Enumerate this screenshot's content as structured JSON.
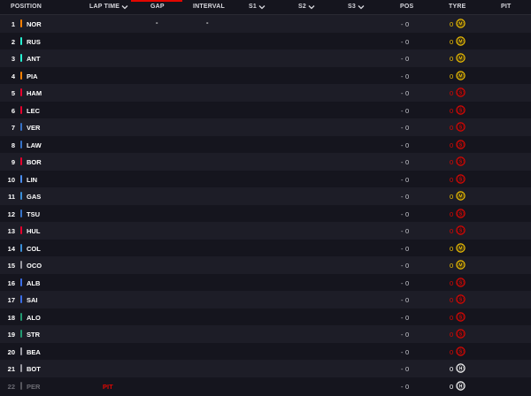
{
  "header": {
    "position": "POSITION",
    "lap_time": "LAP TIME",
    "gap": "GAP",
    "interval": "INTERVAL",
    "s1": "S1",
    "s2": "S2",
    "s3": "S3",
    "pos": "POS",
    "tyre": "TYRE",
    "pit": "PIT"
  },
  "colors": {
    "accent": "#e10600",
    "medium": "#f5c400",
    "soft": "#e10600",
    "hard": "#ffffff",
    "pit_text": "#e10600"
  },
  "drivers": [
    {
      "pos": "1",
      "code": "NOR",
      "team_color": "#ff8000",
      "lap_time": "",
      "gap": "-",
      "interval": "-",
      "pos_change": "-",
      "pos_val": "0",
      "tyre_age": "0",
      "tyre": "M",
      "tyre_color": "#f5c400",
      "tyre_icon": "medium-tyre-icon"
    },
    {
      "pos": "2",
      "code": "RUS",
      "team_color": "#27f4d2",
      "lap_time": "",
      "gap": "",
      "interval": "",
      "pos_change": "-",
      "pos_val": "0",
      "tyre_age": "0",
      "tyre": "M",
      "tyre_color": "#f5c400",
      "tyre_icon": "medium-tyre-icon"
    },
    {
      "pos": "3",
      "code": "ANT",
      "team_color": "#27f4d2",
      "lap_time": "",
      "gap": "",
      "interval": "",
      "pos_change": "-",
      "pos_val": "0",
      "tyre_age": "0",
      "tyre": "M",
      "tyre_color": "#f5c400",
      "tyre_icon": "medium-tyre-icon"
    },
    {
      "pos": "4",
      "code": "PIA",
      "team_color": "#ff8000",
      "lap_time": "",
      "gap": "",
      "interval": "",
      "pos_change": "-",
      "pos_val": "0",
      "tyre_age": "0",
      "tyre": "M",
      "tyre_color": "#f5c400",
      "tyre_icon": "medium-tyre-icon"
    },
    {
      "pos": "5",
      "code": "HAM",
      "team_color": "#e8002d",
      "lap_time": "",
      "gap": "",
      "interval": "",
      "pos_change": "-",
      "pos_val": "0",
      "tyre_age": "0",
      "tyre": "S",
      "tyre_color": "#e10600",
      "tyre_icon": "soft-tyre-icon"
    },
    {
      "pos": "6",
      "code": "LEC",
      "team_color": "#e8002d",
      "lap_time": "",
      "gap": "",
      "interval": "",
      "pos_change": "-",
      "pos_val": "0",
      "tyre_age": "0",
      "tyre": "S",
      "tyre_color": "#e10600",
      "tyre_icon": "soft-tyre-icon"
    },
    {
      "pos": "7",
      "code": "VER",
      "team_color": "#3671c6",
      "lap_time": "",
      "gap": "",
      "interval": "",
      "pos_change": "-",
      "pos_val": "0",
      "tyre_age": "0",
      "tyre": "S",
      "tyre_color": "#e10600",
      "tyre_icon": "soft-tyre-icon"
    },
    {
      "pos": "8",
      "code": "LAW",
      "team_color": "#3671c6",
      "lap_time": "",
      "gap": "",
      "interval": "",
      "pos_change": "-",
      "pos_val": "0",
      "tyre_age": "0",
      "tyre": "S",
      "tyre_color": "#e10600",
      "tyre_icon": "soft-tyre-icon"
    },
    {
      "pos": "9",
      "code": "BOR",
      "team_color": "#e8002d",
      "lap_time": "",
      "gap": "",
      "interval": "",
      "pos_change": "-",
      "pos_val": "0",
      "tyre_age": "0",
      "tyre": "S",
      "tyre_color": "#e10600",
      "tyre_icon": "soft-tyre-icon"
    },
    {
      "pos": "10",
      "code": "LIN",
      "team_color": "#4a8df0",
      "lap_time": "",
      "gap": "",
      "interval": "",
      "pos_change": "-",
      "pos_val": "0",
      "tyre_age": "0",
      "tyre": "S",
      "tyre_color": "#e10600",
      "tyre_icon": "soft-tyre-icon"
    },
    {
      "pos": "11",
      "code": "GAS",
      "team_color": "#3a8fd8",
      "lap_time": "",
      "gap": "",
      "interval": "",
      "pos_change": "-",
      "pos_val": "0",
      "tyre_age": "0",
      "tyre": "M",
      "tyre_color": "#f5c400",
      "tyre_icon": "medium-tyre-icon"
    },
    {
      "pos": "12",
      "code": "TSU",
      "team_color": "#3671c6",
      "lap_time": "",
      "gap": "",
      "interval": "",
      "pos_change": "-",
      "pos_val": "0",
      "tyre_age": "0",
      "tyre": "S",
      "tyre_color": "#e10600",
      "tyre_icon": "soft-tyre-icon"
    },
    {
      "pos": "13",
      "code": "HUL",
      "team_color": "#e8002d",
      "lap_time": "",
      "gap": "",
      "interval": "",
      "pos_change": "-",
      "pos_val": "0",
      "tyre_age": "0",
      "tyre": "S",
      "tyre_color": "#e10600",
      "tyre_icon": "soft-tyre-icon"
    },
    {
      "pos": "14",
      "code": "COL",
      "team_color": "#3a8fd8",
      "lap_time": "",
      "gap": "",
      "interval": "",
      "pos_change": "-",
      "pos_val": "0",
      "tyre_age": "0",
      "tyre": "M",
      "tyre_color": "#f5c400",
      "tyre_icon": "medium-tyre-icon"
    },
    {
      "pos": "15",
      "code": "OCO",
      "team_color": "#9a9aa2",
      "lap_time": "",
      "gap": "",
      "interval": "",
      "pos_change": "-",
      "pos_val": "0",
      "tyre_age": "0",
      "tyre": "M",
      "tyre_color": "#f5c400",
      "tyre_icon": "medium-tyre-icon"
    },
    {
      "pos": "16",
      "code": "ALB",
      "team_color": "#3a6ee8",
      "lap_time": "",
      "gap": "",
      "interval": "",
      "pos_change": "-",
      "pos_val": "0",
      "tyre_age": "0",
      "tyre": "S",
      "tyre_color": "#e10600",
      "tyre_icon": "soft-tyre-icon"
    },
    {
      "pos": "17",
      "code": "SAI",
      "team_color": "#3a6ee8",
      "lap_time": "",
      "gap": "",
      "interval": "",
      "pos_change": "-",
      "pos_val": "0",
      "tyre_age": "0",
      "tyre": "S",
      "tyre_color": "#e10600",
      "tyre_icon": "soft-tyre-icon"
    },
    {
      "pos": "18",
      "code": "ALO",
      "team_color": "#229971",
      "lap_time": "",
      "gap": "",
      "interval": "",
      "pos_change": "-",
      "pos_val": "0",
      "tyre_age": "0",
      "tyre": "S",
      "tyre_color": "#e10600",
      "tyre_icon": "soft-tyre-icon"
    },
    {
      "pos": "19",
      "code": "STR",
      "team_color": "#229971",
      "lap_time": "",
      "gap": "",
      "interval": "",
      "pos_change": "-",
      "pos_val": "0",
      "tyre_age": "0",
      "tyre": "S",
      "tyre_color": "#e10600",
      "tyre_icon": "soft-tyre-icon"
    },
    {
      "pos": "20",
      "code": "BEA",
      "team_color": "#9a9aa2",
      "lap_time": "",
      "gap": "",
      "interval": "",
      "pos_change": "-",
      "pos_val": "0",
      "tyre_age": "0",
      "tyre": "S",
      "tyre_color": "#e10600",
      "tyre_icon": "soft-tyre-icon"
    },
    {
      "pos": "21",
      "code": "BOT",
      "team_color": "#9a9aa2",
      "lap_time": "",
      "gap": "",
      "interval": "",
      "pos_change": "-",
      "pos_val": "0",
      "tyre_age": "0",
      "tyre": "H",
      "tyre_color": "#ffffff",
      "tyre_icon": "hard-tyre-icon"
    },
    {
      "pos": "22",
      "code": "PER",
      "team_color": "#55555d",
      "lap_time": "PIT",
      "gap": "",
      "interval": "",
      "pos_change": "-",
      "pos_val": "0",
      "tyre_age": "0",
      "tyre": "H",
      "tyre_color": "#ffffff",
      "tyre_icon": "hard-tyre-icon",
      "dnf": true
    }
  ]
}
